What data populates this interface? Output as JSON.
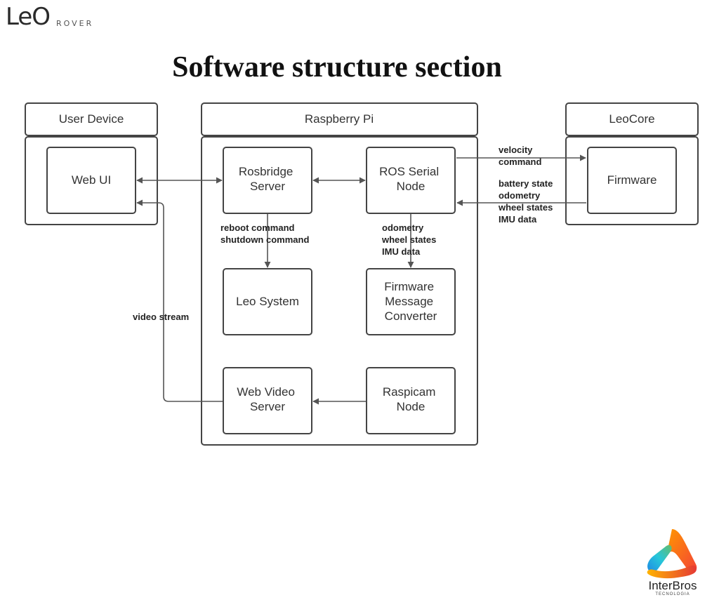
{
  "logo": {
    "word": "LeO",
    "sub": "ROVER"
  },
  "title": "Software structure section",
  "groups": {
    "user_device": "User Device",
    "raspberry_pi": "Raspberry Pi",
    "leocore": "LeoCore"
  },
  "nodes": {
    "web_ui": [
      "Web UI"
    ],
    "rosbridge": [
      "Rosbridge",
      "Server"
    ],
    "ros_serial": [
      "ROS Serial",
      "Node"
    ],
    "firmware": [
      "Firmware"
    ],
    "leo_system": [
      "Leo System"
    ],
    "fw_converter": [
      "Firmware",
      "Message",
      "Converter"
    ],
    "web_video": [
      "Web Video",
      "Server"
    ],
    "raspicam": [
      "Raspicam",
      "Node"
    ]
  },
  "labels": {
    "velocity": [
      "velocity",
      "command"
    ],
    "battery": [
      "battery state",
      "odometry",
      "wheel states",
      "IMU data"
    ],
    "reboot": [
      "reboot command",
      "shutdown command"
    ],
    "odometry": [
      "odometry",
      "wheel states",
      "IMU data"
    ],
    "video": [
      "video stream"
    ]
  },
  "brand": {
    "name": "InterBros",
    "sub": "TECNOLOGIA"
  }
}
